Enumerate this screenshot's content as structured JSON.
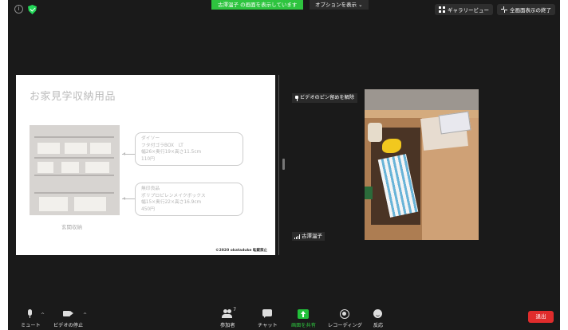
{
  "top_bar": {
    "info_icon": "i",
    "share_banner": "古澤温子 の画面を表示しています",
    "options_button": "オプションを表示 ⌄",
    "gallery_view": "ギャラリービュー",
    "exit_fullscreen": "全画面表示の終了"
  },
  "slide": {
    "title": "お家見学収納用品",
    "box1": {
      "brand": "ダイソー",
      "product": "フタ付ゴラBOX　LT",
      "size": "幅26×奥行19×高さ11.5cm",
      "price": "110円"
    },
    "box2": {
      "brand": "無印良品",
      "product": "ポリプロピレンメイクボックス",
      "size": "幅15×奥行22×高さ16.9cm",
      "price": "450円"
    },
    "caption": "玄関収納",
    "copyright": "©2020 okataduke 転載禁止"
  },
  "video_panel": {
    "unpin_label": "ビデオのピン留めを解除",
    "participant_name": "古澤温子"
  },
  "toolbar": {
    "mute": "ミュート",
    "stop_video": "ビデオの停止",
    "participants": "参加者",
    "participant_count": "7",
    "chat": "チャット",
    "share_screen": "画面を共有",
    "recording": "レコーディング",
    "reactions": "反応",
    "leave": "退出"
  },
  "colors": {
    "background": "#1a1a1a",
    "share_green": "#2ec43f",
    "leave_red": "#e02c2c",
    "security_green": "#23d959"
  }
}
